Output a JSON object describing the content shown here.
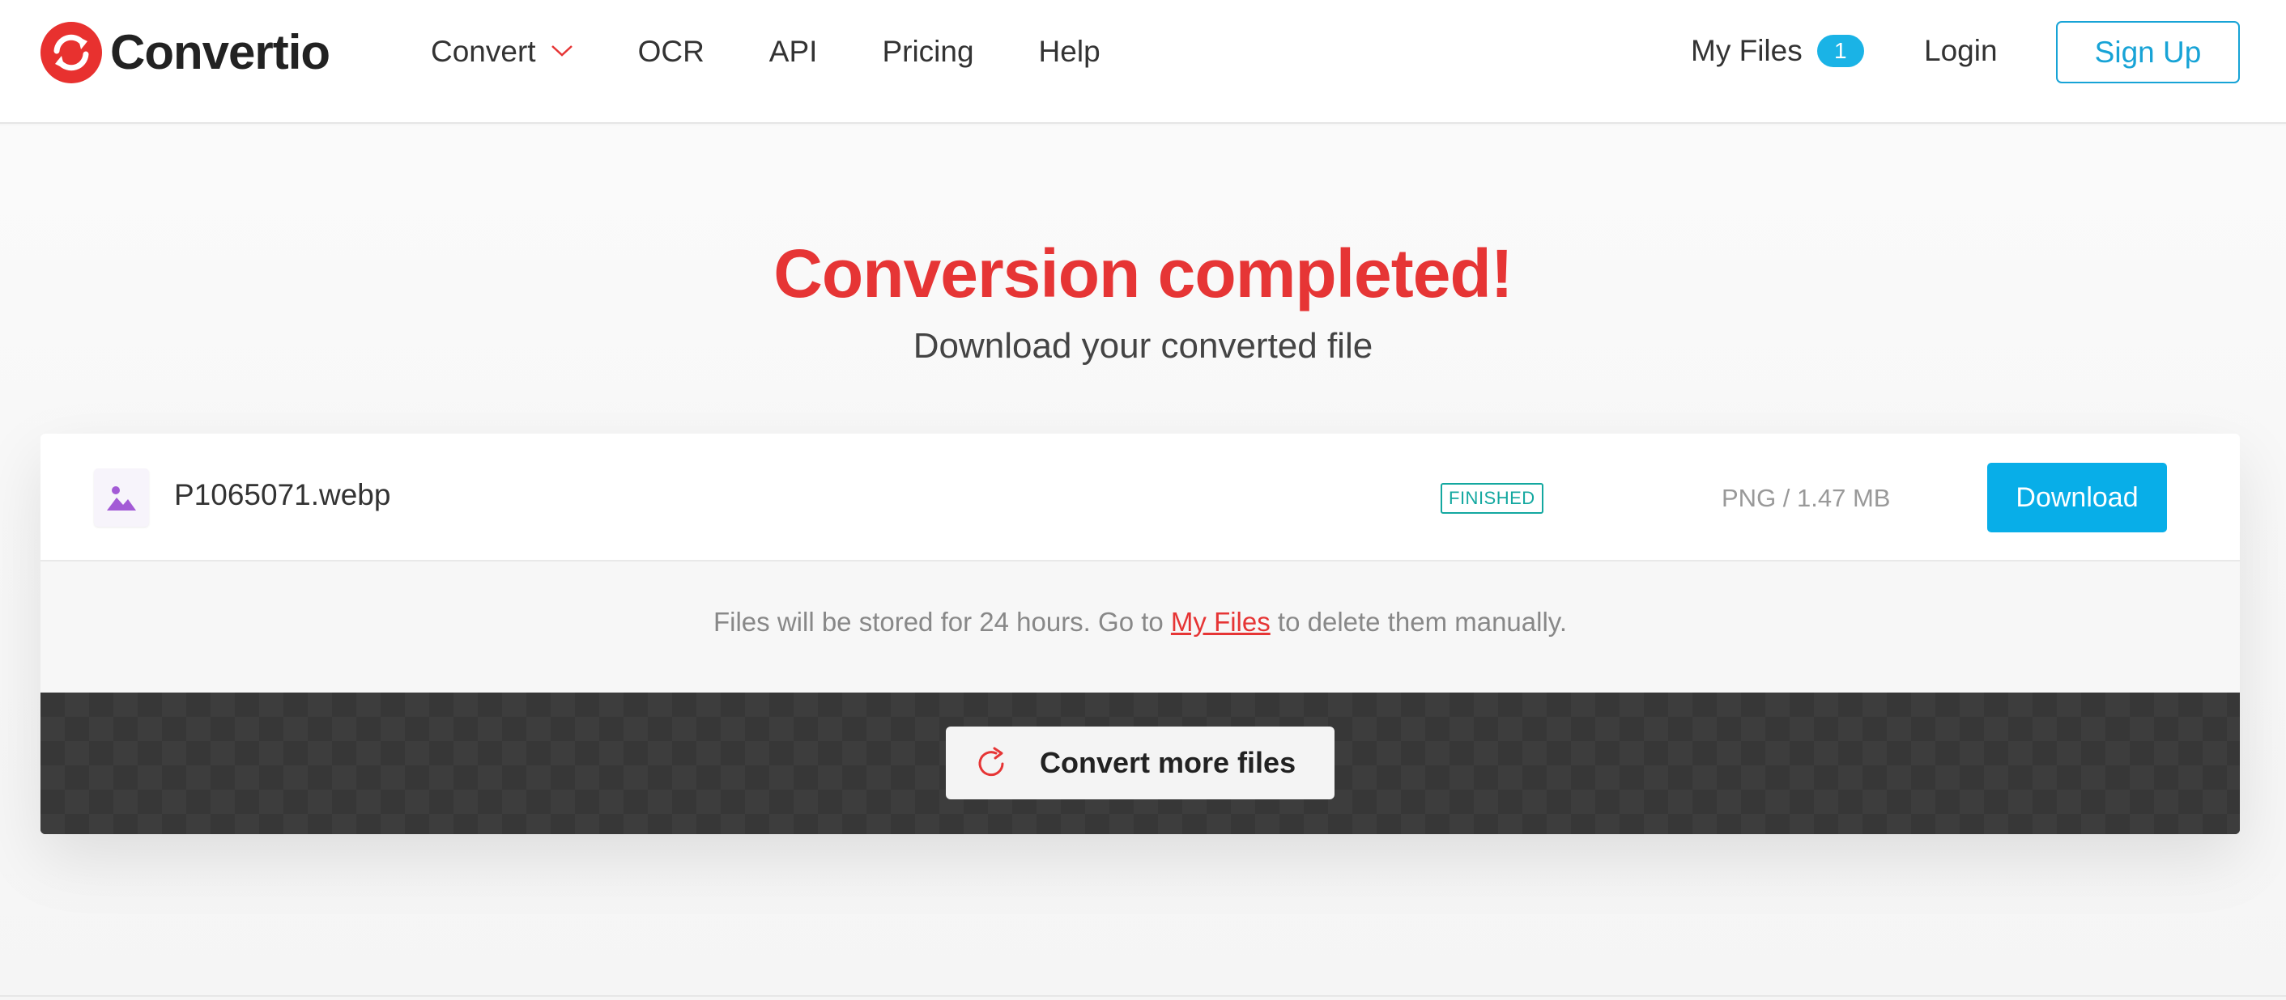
{
  "header": {
    "logo_text": "Convertio",
    "nav": [
      {
        "label": "Convert"
      },
      {
        "label": "OCR"
      },
      {
        "label": "API"
      },
      {
        "label": "Pricing"
      },
      {
        "label": "Help"
      }
    ],
    "my_files_label": "My Files",
    "my_files_count": "1",
    "login_label": "Login",
    "signup_label": "Sign Up"
  },
  "main": {
    "title": "Conversion completed!",
    "subtitle": "Download your converted file"
  },
  "file": {
    "name": "P1065071.webp",
    "status": "FINISHED",
    "info": "PNG / 1.47 MB",
    "download_label": "Download"
  },
  "notice": {
    "prefix": "Files will be stored for 24 hours. Go to ",
    "link_label": "My Files",
    "suffix": " to delete them manually."
  },
  "convert_more_label": "Convert more files",
  "icons": {
    "logo": "convertio-logo-icon",
    "convert_dropdown": "chevron-down-icon",
    "file_type": "image-file-icon",
    "convert_more": "refresh-icon"
  },
  "colors": {
    "brand_red": "#e63535",
    "accent_blue": "#08aee8",
    "status_teal": "#13a8a0",
    "dark_panel": "#373737"
  }
}
